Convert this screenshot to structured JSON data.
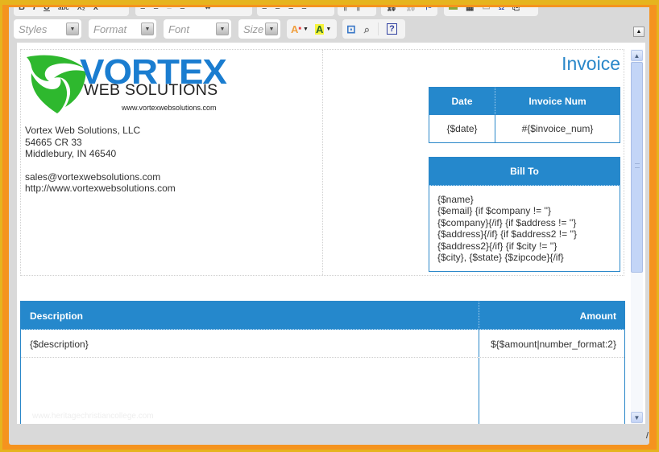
{
  "toolbar": {
    "row1_groups": [
      {
        "name": "basic-styles",
        "items": [
          "bold",
          "italic",
          "underline",
          "strikethrough",
          "subscript",
          "remove-format"
        ]
      },
      {
        "name": "lists-indent",
        "items": [
          "numbered-list",
          "bulleted-list",
          "outdent",
          "indent",
          "blockquote",
          "create-div"
        ]
      },
      {
        "name": "alignment",
        "items": [
          "align-left",
          "align-center",
          "align-right",
          "justify"
        ]
      },
      {
        "name": "bidi",
        "items": [
          "ltr",
          "rtl"
        ]
      },
      {
        "name": "links",
        "items": [
          "link",
          "unlink",
          "anchor"
        ]
      },
      {
        "name": "insert",
        "items": [
          "image",
          "table",
          "horizontal-rule",
          "special-char",
          "page-break"
        ]
      }
    ],
    "styles_label": "Styles",
    "format_label": "Format",
    "font_label": "Font",
    "size_label": "Size",
    "text_color_glyph": "A",
    "bg_color_glyph": "A",
    "help_glyph": "?"
  },
  "document": {
    "logo": {
      "word": "VORTEX",
      "sub": "WEB SOLUTIONS",
      "url": "www.vortexwebsolutions.com"
    },
    "company_lines": [
      "Vortex Web Solutions, LLC",
      "54665 CR 33",
      "Middlebury, IN 46540"
    ],
    "contact_lines": [
      "sales@vortexwebsolutions.com",
      "http://www.vortexwebsolutions.com"
    ],
    "invoice_title": "Invoice",
    "meta": {
      "headers": [
        "Date",
        "Invoice Num"
      ],
      "values": [
        "{$date}",
        "#{$invoice_num}"
      ]
    },
    "bill_to": {
      "header": "Bill To",
      "lines": [
        "{$name}",
        "{$email} {if $company != ''}",
        "{$company}{/if} {if $address != ''}",
        "{$address}{/if} {if $address2 != ''}",
        "{$address2}{/if} {if $city != ''}",
        "{$city}, {$state} {$zipcode}{/if}"
      ]
    },
    "items": {
      "headers": [
        "Description",
        "Amount"
      ],
      "rows": [
        [
          "{$description}",
          "${$amount|number_format:2}"
        ]
      ]
    },
    "watermark": "www.heritagechristiancollege.com"
  },
  "colors": {
    "accent_blue": "#2588cc",
    "logo_green": "#2eb82e",
    "frame_orange": "#f5931e"
  }
}
